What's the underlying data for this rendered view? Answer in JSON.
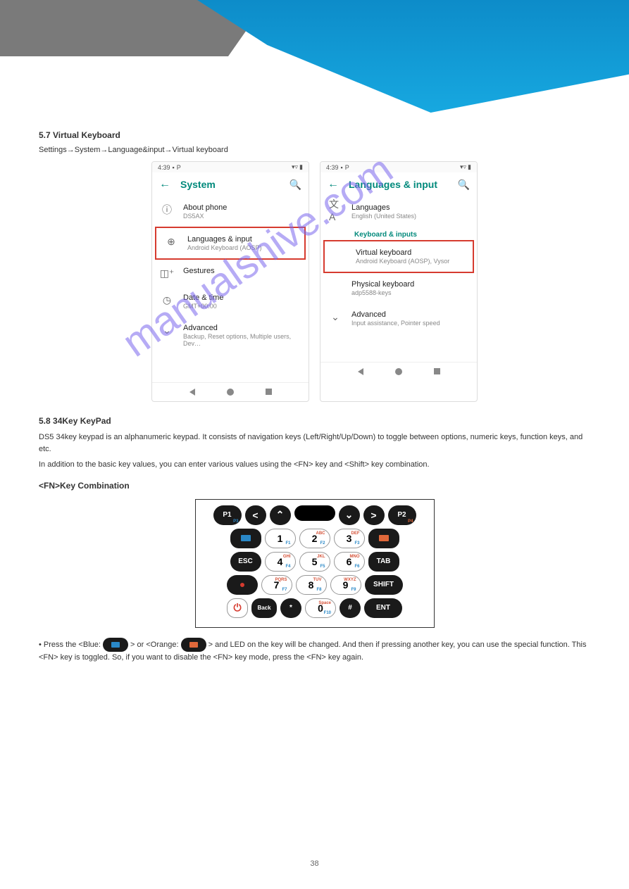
{
  "header": {
    "page_number": "38"
  },
  "section1": {
    "title": "5.7 Virtual Keyboard",
    "desc": "Settings→System→Language&input→Virtual keyboard"
  },
  "phone1": {
    "time": "4:39",
    "title": "System",
    "rows": [
      {
        "title": "About phone",
        "sub": "DS5AX"
      },
      {
        "title": "Languages & input",
        "sub": "Android Keyboard (AOSP)"
      },
      {
        "title": "Gestures",
        "sub": ""
      },
      {
        "title": "Date & time",
        "sub": "GMT+00:00"
      },
      {
        "title": "Advanced",
        "sub": "Backup, Reset options, Multiple users, Dev…"
      }
    ]
  },
  "phone2": {
    "time": "4:39",
    "title": "Languages & input",
    "rows": [
      {
        "title": "Languages",
        "sub": "English (United States)"
      }
    ],
    "section_label": "Keyboard & inputs",
    "rows2": [
      {
        "title": "Virtual keyboard",
        "sub": "Android Keyboard (AOSP), Vysor"
      },
      {
        "title": "Physical keyboard",
        "sub": "adp5588-keys"
      },
      {
        "title": "Advanced",
        "sub": "Input assistance, Pointer speed"
      }
    ]
  },
  "watermark": "manualshive.com",
  "kb": {
    "title": "5.8 34Key KeyPad",
    "p1": "DS5 34key keypad is an alphanumeric keypad. It consists of navigation keys (Left/Right/Up/Down) to toggle between options, numeric keys, function keys, and etc.",
    "p2": "In addition to the basic key values, you can enter various values using the <FN> key and <Shift> key combination.",
    "sub": "<FN>Key Combination",
    "final": "• Press the <Blue:         > or <Orange:         > and LED on the key will be changed. And then if pressing another key, you can use the special function. This <FN> key is toggled. So, if you want to disable the <FN> key mode, press the <FN> key again."
  },
  "keypad": {
    "p1": "P1",
    "p1_sub": "P3",
    "p2": "P2",
    "p2_sub": "P4",
    "nums": [
      {
        "n": "1",
        "fn": "F1"
      },
      {
        "n": "2",
        "abc": "ABC",
        "fn": "F2"
      },
      {
        "n": "3",
        "abc": "DEF",
        "fn": "F3"
      },
      {
        "n": "4",
        "abc": "GHI",
        "fn": "F4"
      },
      {
        "n": "5",
        "abc": "JKL",
        "fn": "F5"
      },
      {
        "n": "6",
        "abc": "MNO",
        "fn": "F6"
      },
      {
        "n": "7",
        "abc": "PQRS",
        "fn": "F7"
      },
      {
        "n": "8",
        "abc": "TUV",
        "fn": "F8"
      },
      {
        "n": "9",
        "abc": "WXYZ",
        "fn": "F9"
      },
      {
        "n": "0",
        "abc": "Space",
        "fn": "F10"
      }
    ],
    "esc": "ESC",
    "tab": "TAB",
    "shift": "SHIFT",
    "back": "Back",
    "ent": "ENT",
    "star": "*",
    "hash": "#"
  }
}
